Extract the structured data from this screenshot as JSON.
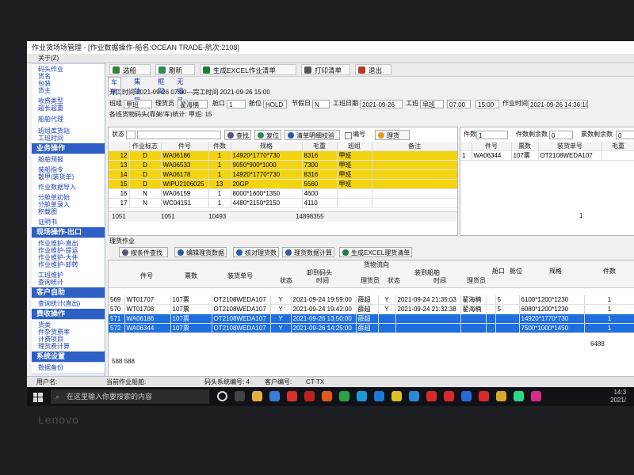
{
  "window": {
    "title": "作业货场场管理 - [作业数据操作-船名:OCEAN TRADE-航次:2108]",
    "menu": "关于(Z)"
  },
  "sidebar": {
    "top_items": [
      "码头作业",
      "货名",
      "包装",
      "货主",
      "收费类型",
      "超长超重",
      "船舶代理",
      "班组库货站",
      "工班时间"
    ],
    "groups": [
      {
        "head": "业务操作",
        "items": [
          "船舶预报",
          "装船指令",
          "散甲(装货单)",
          "作业数据导入",
          "分舱单初始",
          "分舱单录入",
          "积载图",
          "证明书"
        ]
      },
      {
        "head": "现场操作-出口",
        "items": [
          "作业维护-直出",
          "作业维护-提运",
          "作业维护-大件",
          "作业维护-卸转",
          "工班维护",
          "查询统计"
        ]
      },
      {
        "head": "客户自助",
        "items": [
          "查询统计(直出)"
        ]
      },
      {
        "head": "费收操作",
        "items": [
          "货类",
          "件杂货费率",
          "计费项目",
          "理货费计算"
        ]
      },
      {
        "head": "系统设置",
        "items": [
          "数据备份"
        ]
      }
    ]
  },
  "toolbar": {
    "buttons": [
      "选船",
      "刷新",
      "生成EXCEL作业清单",
      "打印清单",
      "退出"
    ]
  },
  "tabs": [
    "车辆",
    "集装箱",
    "框架",
    "无编号"
  ],
  "form": {
    "work_time": "开工时间 2021-09-26 07:00---完工时间 2021-09-26 15:00",
    "shift_label": "班组",
    "shift": "甲班",
    "tallyman_label": "理货员",
    "tallyman": "翟海楠",
    "hatch_label": "舱口",
    "hatch": "1",
    "position_label": "舱位",
    "position": "HOLD",
    "holiday_label": "节假日",
    "holiday": "N",
    "date_label": "工班日期",
    "date": "2021-09-26",
    "class_label": "工班",
    "class": "早班",
    "start": "07:00",
    "end": "15:00",
    "worktime_label": "作业时间",
    "worktime": "2021-09-26 14:36:10",
    "summary": "各班货物码头(靠架/车)统计: 甲班: 15"
  },
  "upper_grid": {
    "state_label": "状态",
    "search_btn": "查找",
    "reset_btn": "复位",
    "verify_btn": "清单明细校验",
    "chk_label": "编号",
    "tally_btn": "理货",
    "headers": [
      "作业标志",
      "件号",
      "件数",
      "规格",
      "毛重",
      "班组",
      "备注"
    ],
    "rows": [
      {
        "no": "12",
        "flag": "D",
        "piece": "WA06186",
        "qty": "1",
        "spec": "14920*1770*730",
        "gross": "8316",
        "shift": "甲班",
        "hl": "yel"
      },
      {
        "no": "13",
        "flag": "D",
        "piece": "WA06533",
        "qty": "1",
        "spec": "9050*900*1000",
        "gross": "7300",
        "shift": "甲班",
        "hl": "yel"
      },
      {
        "no": "14",
        "flag": "D",
        "piece": "WA06178",
        "qty": "1",
        "spec": "14920*1770*730",
        "gross": "8316",
        "shift": "甲班",
        "hl": "yel"
      },
      {
        "no": "15",
        "flag": "D",
        "piece": "WIPU2106025",
        "qty": "13",
        "spec": "20GP",
        "gross": "5560",
        "shift": "甲班",
        "hl": "yel"
      },
      {
        "no": "16",
        "flag": "N",
        "piece": "WA06159",
        "qty": "1",
        "spec": "8000*1600*1350",
        "gross": "4600",
        "shift": "",
        "hl": ""
      },
      {
        "no": "17",
        "flag": "N",
        "piece": "WC04151",
        "qty": "1",
        "spec": "4480*2150*2150",
        "gross": "4110",
        "shift": "",
        "hl": ""
      }
    ],
    "footer": [
      "1051",
      "1051",
      "10493",
      "14898355"
    ]
  },
  "right_grid": {
    "count_label": "件数",
    "count": "1",
    "remain_label": "件数剩余数",
    "remain": "0",
    "ticket_remain_label": "票数剩余数",
    "ticket_remain": "0",
    "headers": [
      "件号",
      "票数",
      "装货单号",
      "毛重"
    ],
    "rows": [
      {
        "mark": "1",
        "piece": "WA06344",
        "tickets": "107票",
        "order": "OT2108WEDA107"
      }
    ],
    "footer": "1"
  },
  "tally": {
    "section": "理货作业",
    "buttons": [
      "按条件查找",
      "编辑理货数据",
      "核对理货数",
      "理货数据计算",
      "生成EXCEL理货清单"
    ],
    "group_head": "货物流向",
    "sub_head_a": "卸到码头",
    "sub_head_b": "装到船舶",
    "headers": [
      "件号",
      "票数",
      "装货单号",
      "状态",
      "时间",
      "理货员",
      "状态",
      "时间",
      "理货员",
      "舱口",
      "舱位",
      "规格",
      "件数"
    ],
    "rows": [
      {
        "no": "569",
        "piece": "WT01707",
        "tickets": "107票",
        "order": "OT2108WEDA107",
        "s1": "Y",
        "t1": "2021-09-24 19:59:00",
        "p1": "薛超",
        "s2": "Y",
        "t2": "2021-09-24 21:35:03",
        "p2": "翟海楠",
        "hatch": "5",
        "pos": "HOLD",
        "spec": "6100*1200*1230",
        "qty": "1",
        "hl": ""
      },
      {
        "no": "570",
        "piece": "WT01708",
        "tickets": "107票",
        "order": "OT2108WEDA107",
        "s1": "Y",
        "t1": "2021-09-24 19:42:00",
        "p1": "薛超",
        "s2": "Y",
        "t2": "2021-09-24 21:32:38",
        "p2": "翟海楠",
        "hatch": "5",
        "pos": "HOLD",
        "spec": "6080*1200*1230",
        "qty": "1",
        "hl": ""
      },
      {
        "no": "571",
        "piece": "WA06186",
        "tickets": "107票",
        "order": "OT2108WEDA107",
        "s1": "Y",
        "t1": "2021-09-26 13:50:00",
        "p1": "薛超",
        "s2": "",
        "t2": "",
        "p2": "",
        "hatch": "",
        "pos": "",
        "spec": "14920*1770*730",
        "qty": "1",
        "hl": "blu"
      },
      {
        "no": "572",
        "piece": "WA06344",
        "tickets": "107票",
        "order": "OT2108WEDA107",
        "s1": "Y",
        "t1": "2021-09-26 14:25:00",
        "p1": "薛超",
        "s2": "",
        "t2": "",
        "p2": "",
        "hatch": "",
        "pos": "",
        "spec": "7500*1000*1450",
        "qty": "1",
        "hl": "blu"
      }
    ],
    "footer_left": "588  588",
    "footer_right": "6488"
  },
  "status": {
    "user": "用户名:",
    "ship": "当前作业船舶:",
    "berth": "码头系统编号: 4",
    "client": "客户编号:",
    "code": "CT-TX"
  },
  "taskbar": {
    "search": "在这里输入你要搜索的内容",
    "time": "14:3",
    "date": "2021/"
  },
  "brand": "Lenovo"
}
